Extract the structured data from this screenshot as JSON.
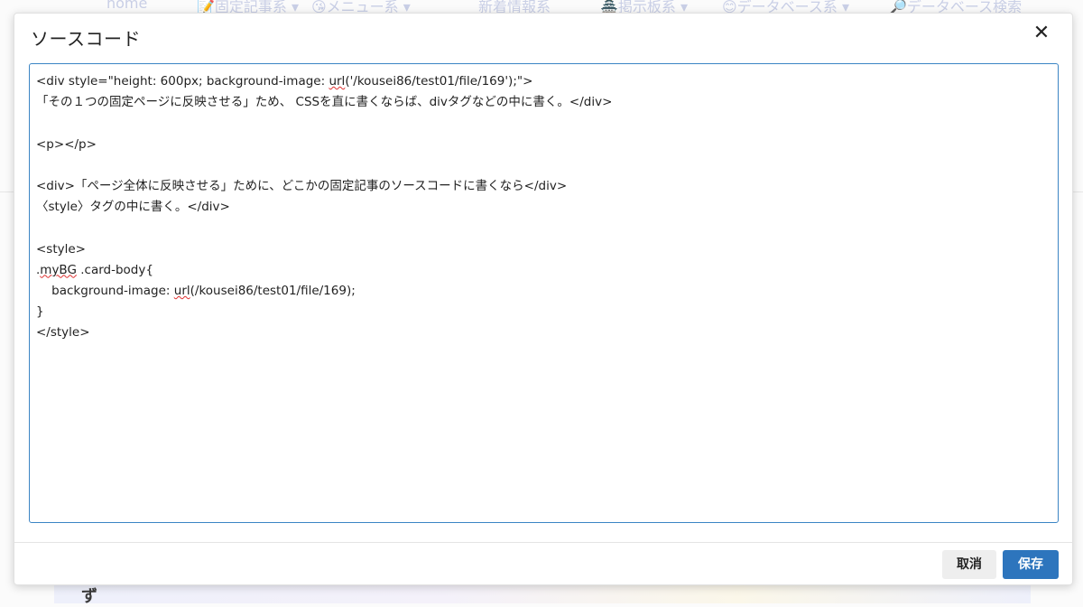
{
  "background": {
    "nav": [
      "home",
      "📝固定記事系 ▾",
      "😘メニュー系 ▾",
      "新着情報系",
      "🏯掲示板系 ▾",
      "😊データベース系 ▾",
      "🔎データベース検索"
    ],
    "glyph": "ず"
  },
  "modal": {
    "title": "ソースコード",
    "close_symbol": "✕",
    "editor_lines": [
      "<div style=\"height: 600px; background-image: url('/kousei86/test01/file/169');\">",
      "「その１つの固定ページに反映させる」ため、 CSSを直に書くならば、divタグなどの中に書く。</div>",
      "",
      "<p></p>",
      "",
      "<div>「ページ全体に反映させる」ために、どこかの固定記事のソースコードに書くなら</div>",
      "〈style〉タグの中に書く。</div>",
      "",
      "<style>",
      ".myBG .card-body{",
      "    background-image: url(/kousei86/test01/file/169);",
      "}",
      "</style>"
    ],
    "cancel_label": "取消",
    "save_label": "保存"
  },
  "colors": {
    "accent": "#2d75bd",
    "editor_border": "#3b85c4"
  }
}
